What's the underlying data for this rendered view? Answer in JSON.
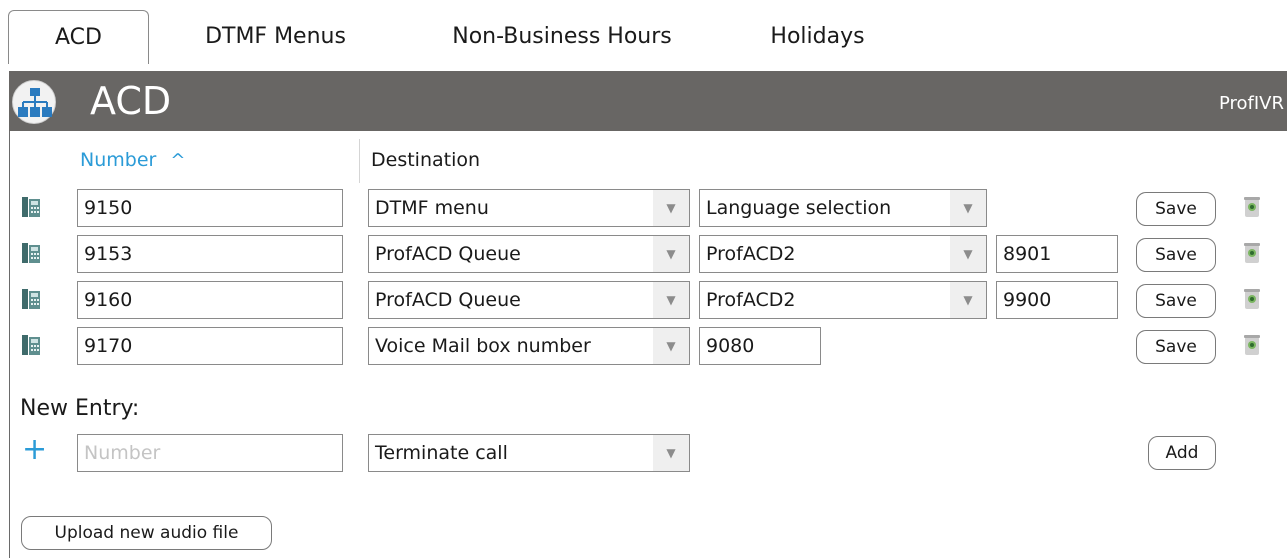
{
  "tabs": [
    {
      "label": "ACD",
      "active": true
    },
    {
      "label": "DTMF Menus",
      "active": false
    },
    {
      "label": "Non-Business Hours",
      "active": false
    },
    {
      "label": "Holidays",
      "active": false
    }
  ],
  "header": {
    "title": "ACD",
    "brand": "ProfIVR",
    "icon": "call-tree-icon"
  },
  "columns": {
    "number": "Number",
    "destination": "Destination",
    "sort_indicator": "^"
  },
  "rows": [
    {
      "number": "9150",
      "type": "DTMF menu",
      "target": "Language selection",
      "extra": "",
      "save_label": "Save"
    },
    {
      "number": "9153",
      "type": "ProfACD Queue",
      "target": "ProfACD2",
      "extra": "8901",
      "save_label": "Save"
    },
    {
      "number": "9160",
      "type": "ProfACD Queue",
      "target": "ProfACD2",
      "extra": "9900",
      "save_label": "Save"
    },
    {
      "number": "9170",
      "type": "Voice Mail box number",
      "target": "9080",
      "extra": "",
      "save_label": "Save"
    }
  ],
  "new_entry": {
    "label": "New Entry:",
    "plus": "+",
    "number_placeholder": "Number",
    "type": "Terminate call",
    "add_label": "Add"
  },
  "upload_label": "Upload new audio file",
  "colors": {
    "accent": "#2b9bd7",
    "header_bg": "#686664",
    "trash_green": "#7bb661"
  }
}
